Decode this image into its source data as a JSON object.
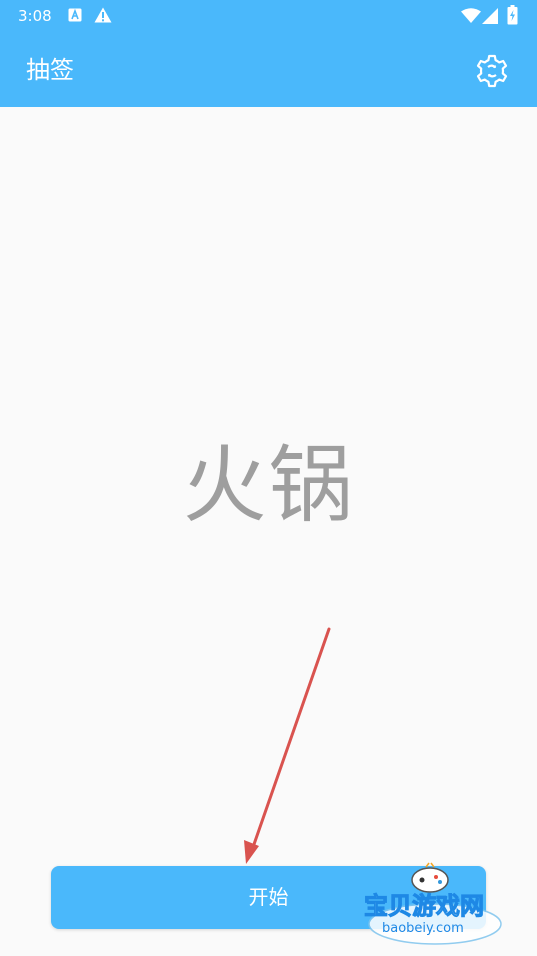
{
  "status_bar": {
    "time": "3:08",
    "icons": [
      "notification-a-icon",
      "warning-icon",
      "wifi-icon",
      "signal-icon",
      "battery-charging-icon"
    ]
  },
  "app_bar": {
    "title": "抽签",
    "settings_icon": "gear-icon"
  },
  "main": {
    "result": "火锅"
  },
  "start_button": {
    "label": "开始"
  },
  "watermark": {
    "name": "宝贝游戏网",
    "url": "baobeiy.com"
  },
  "colors": {
    "primary": "#4ab8fb",
    "background": "#fafafa",
    "result_text": "#9e9e9e",
    "arrow": "#d9534f"
  }
}
